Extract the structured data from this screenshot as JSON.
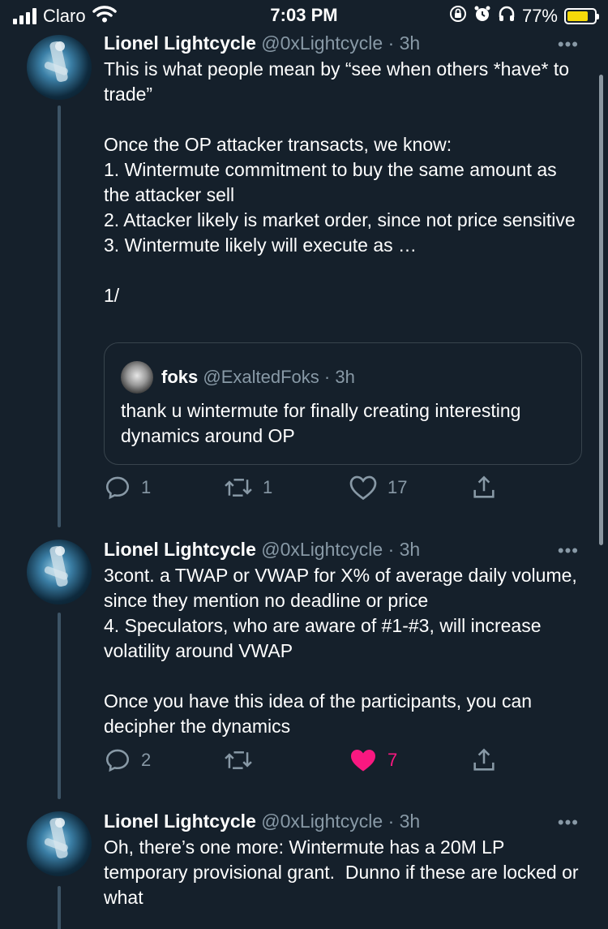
{
  "status_bar": {
    "carrier": "Claro",
    "time": "7:03 PM",
    "battery": "77%",
    "battery_level": 0.77,
    "icons": [
      "signal-icon",
      "wifi-icon",
      "orientation-lock-icon",
      "alarm-icon",
      "headphones-icon",
      "battery-icon"
    ]
  },
  "tweets": [
    {
      "name": "Lionel Lightcycle",
      "handle": "@0xLightcycle",
      "time": "· 3h",
      "more": "•••",
      "text": "This is what people mean by “see when others *have* to trade”\n\nOnce the OP attacker transacts, we know:\n1. Wintermute commitment to buy the same amount as the attacker sell\n2. Attacker likely is market order, since not price sensitive\n3. Wintermute likely will execute as …\n\n1/",
      "quote": {
        "name": "foks",
        "handle": "@ExaltedFoks",
        "time": "· 3h",
        "text": "thank u wintermute for finally creating interesting dynamics around OP"
      },
      "replies": "1",
      "retweets": "1",
      "likes": "17"
    },
    {
      "name": "Lionel Lightcycle",
      "handle": "@0xLightcycle",
      "time": "· 3h",
      "more": "•••",
      "text": "3cont. a TWAP or VWAP for X% of average daily volume, since they mention no deadline or price\n4. Speculators, who are aware of #1-#3, will increase volatility around VWAP\n\nOnce you have this idea of the participants, you can decipher the dynamics",
      "replies": "2",
      "retweets": "",
      "likes": "7",
      "liked": true
    },
    {
      "name": "Lionel Lightcycle",
      "handle": "@0xLightcycle",
      "time": "· 3h",
      "more": "•••",
      "text": "Oh, there’s one more: Wintermute has a 20M LP temporary provisional grant.  Dunno if these are locked or what"
    }
  ],
  "colors": {
    "background": "#15202b",
    "secondary_text": "#8899a6",
    "like": "#f91880",
    "border": "#38444d"
  }
}
